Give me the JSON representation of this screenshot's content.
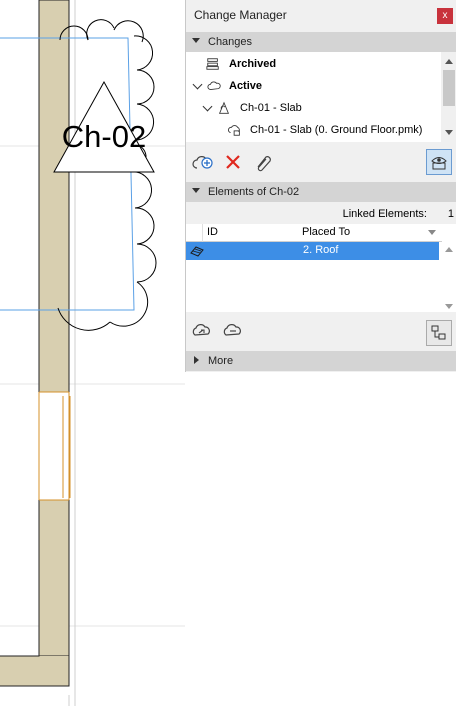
{
  "canvas": {
    "change_marker_label": "Ch-02"
  },
  "panel": {
    "title": "Change Manager",
    "close_label": "x",
    "changes_section": {
      "header": "Changes",
      "tree": [
        {
          "label": "Archived",
          "bold": true,
          "icon": "archive-icon"
        },
        {
          "label": "Active",
          "bold": true,
          "icon": "cloud-icon"
        },
        {
          "label": "Ch-01 - Slab",
          "bold": false,
          "icon": "change-icon"
        },
        {
          "label": "Ch-01 - Slab (0. Ground Floor.pmk)",
          "bold": false,
          "icon": "cloud-lock-icon"
        }
      ]
    },
    "changes_toolbar": {
      "icons": [
        "new-change-icon",
        "delete-icon",
        "link-icon",
        "show-marker-icon"
      ]
    },
    "elements_section": {
      "header": "Elements of Ch-02",
      "linked_label": "Linked Elements:",
      "linked_count": "1",
      "columns": [
        "ID",
        "Placed To"
      ],
      "rows": [
        {
          "id": "",
          "placed_to": "2. Roof",
          "icon": "roof-element-icon"
        }
      ]
    },
    "elements_toolbar": {
      "icons": [
        "link-elements-icon",
        "unlink-elements-icon",
        "select-elements-icon"
      ]
    },
    "more_section": {
      "header": "More"
    }
  },
  "colors": {
    "wall_fill": "#d8cfb0",
    "selection": "#3d8ee6",
    "guide_line": "#5aa0e6",
    "opening": "#d4902a"
  }
}
